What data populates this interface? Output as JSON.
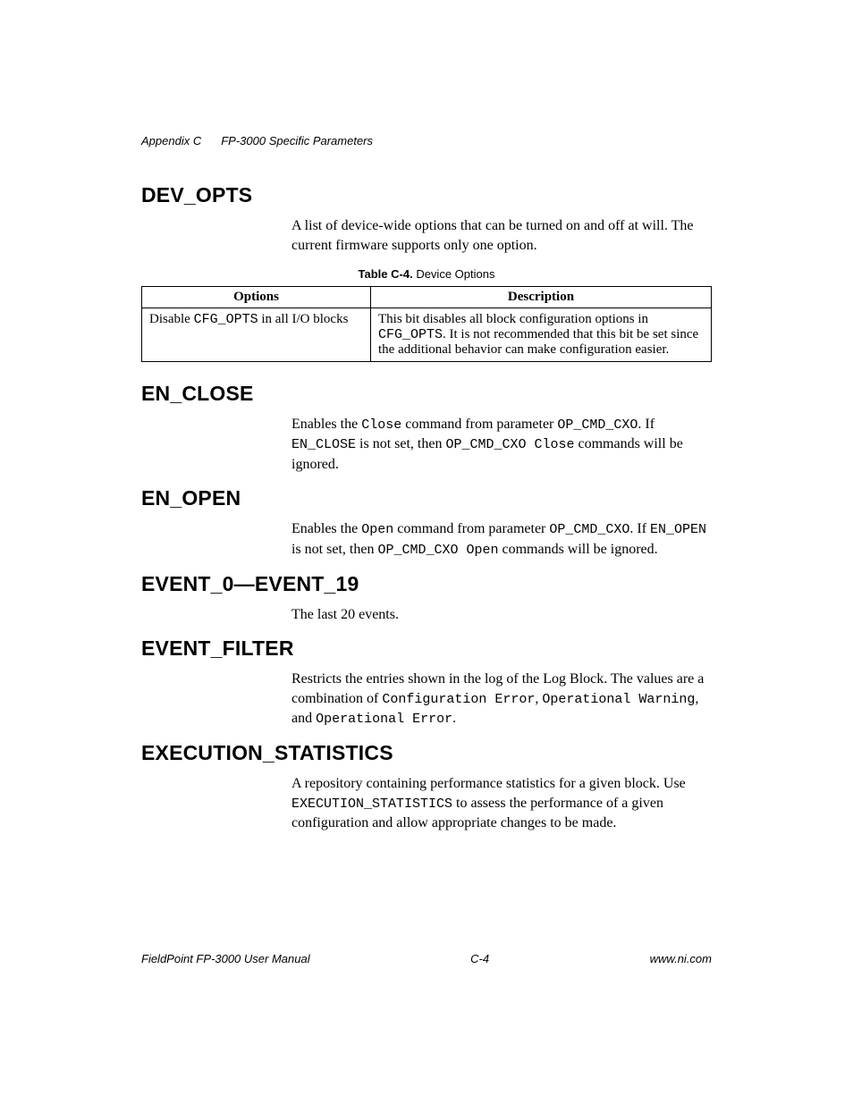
{
  "header": {
    "appendix": "Appendix C",
    "title": "FP-3000 Specific Parameters"
  },
  "sections": {
    "dev_opts": {
      "heading": "DEV_OPTS",
      "body": "A list of device-wide options that can be turned on and off at will. The current firmware supports only one option.",
      "table_label_bold": "Table C-4.",
      "table_label_rest": "Device Options",
      "table": {
        "col1": "Options",
        "col2": "Description",
        "row1_opt_prefix": "Disable ",
        "row1_opt_mono": "CFG_OPTS",
        "row1_opt_suffix": " in all I/O blocks",
        "row1_desc_p1": "This bit disables all block configuration options in ",
        "row1_desc_mono": "CFG_OPTS",
        "row1_desc_p2": ". It is not recommended that this bit be set since the additional behavior can make configuration easier."
      }
    },
    "en_close": {
      "heading": "EN_CLOSE",
      "t1": "Enables the ",
      "m1": "Close",
      "t2": " command from parameter ",
      "m2": "OP_CMD_CXO",
      "t3": ". If ",
      "m3": "EN_CLOSE",
      "t4": " is not set, then ",
      "m4": "OP_CMD_CXO Close",
      "t5": " commands will be ignored."
    },
    "en_open": {
      "heading": "EN_OPEN",
      "t1": "Enables the ",
      "m1": "Open",
      "t2": " command from parameter ",
      "m2": "OP_CMD_CXO",
      "t3": ". If ",
      "m3": "EN_OPEN",
      "t4": " is not set, then ",
      "m4": "OP_CMD_CXO Open",
      "t5": " commands will be ignored."
    },
    "event_0_19": {
      "heading": "EVENT_0—EVENT_19",
      "body": "The last 20 events."
    },
    "event_filter": {
      "heading": "EVENT_FILTER",
      "t1": "Restricts the entries shown in the log of the Log Block. The values are a combination of ",
      "m1": "Configuration Error",
      "t2": ", ",
      "m2": "Operational Warning",
      "t3": ", and ",
      "m3": "Operational Error",
      "t4": "."
    },
    "execution_statistics": {
      "heading": "EXECUTION_STATISTICS",
      "t1": "A repository containing performance statistics for a given block. Use ",
      "m1": "EXECUTION_STATISTICS",
      "t2": " to assess the performance of a given configuration and allow appropriate changes to be made."
    }
  },
  "footer": {
    "left": "FieldPoint FP-3000 User Manual",
    "center": "C-4",
    "right": "www.ni.com"
  }
}
